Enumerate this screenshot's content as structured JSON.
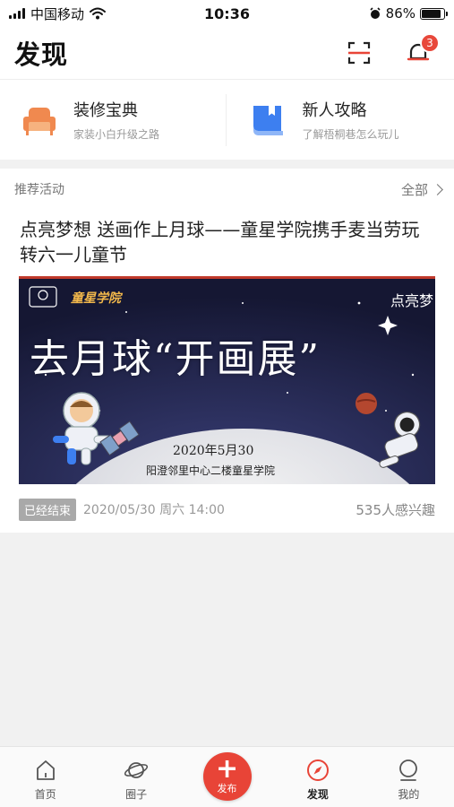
{
  "status_bar": {
    "carrier": "中国移动",
    "time": "10:36",
    "battery_percent": "86%",
    "battery_level": 0.86
  },
  "header": {
    "title": "发现",
    "notification_count": "3"
  },
  "quick_entries": [
    {
      "title": "装修宝典",
      "subtitle": "家装小白升级之路",
      "icon": "sofa-icon",
      "color": "#f0894f"
    },
    {
      "title": "新人攻略",
      "subtitle": "了解梧桐巷怎么玩儿",
      "icon": "book-icon",
      "color": "#3d7ff0"
    }
  ],
  "activities": {
    "section_title": "推荐活动",
    "more_label": "全部",
    "item": {
      "title": "点亮梦想 送画作上月球——童星学院携手麦当劳玩转六一儿童节",
      "banner": {
        "brand": "童星学院",
        "corner_text": "点亮梦",
        "headline": "去月球“开画展”",
        "date": "2020年5月30",
        "venue": "阳澄邻里中心二楼童星学院"
      },
      "status": "已经结束",
      "time": "2020/05/30 周六 14:00",
      "interest": "535人感兴趣"
    }
  },
  "tab_bar": {
    "tabs": [
      {
        "label": "首页",
        "icon": "home-icon"
      },
      {
        "label": "圈子",
        "icon": "planet-icon"
      },
      {
        "label": "发布",
        "icon": "plus-icon"
      },
      {
        "label": "发现",
        "icon": "compass-icon"
      },
      {
        "label": "我的",
        "icon": "profile-icon"
      }
    ],
    "active": "发现"
  },
  "colors": {
    "accent": "#e84437",
    "badge": "#e8483b",
    "sofa": "#f0894f",
    "book": "#3d7ff0"
  }
}
